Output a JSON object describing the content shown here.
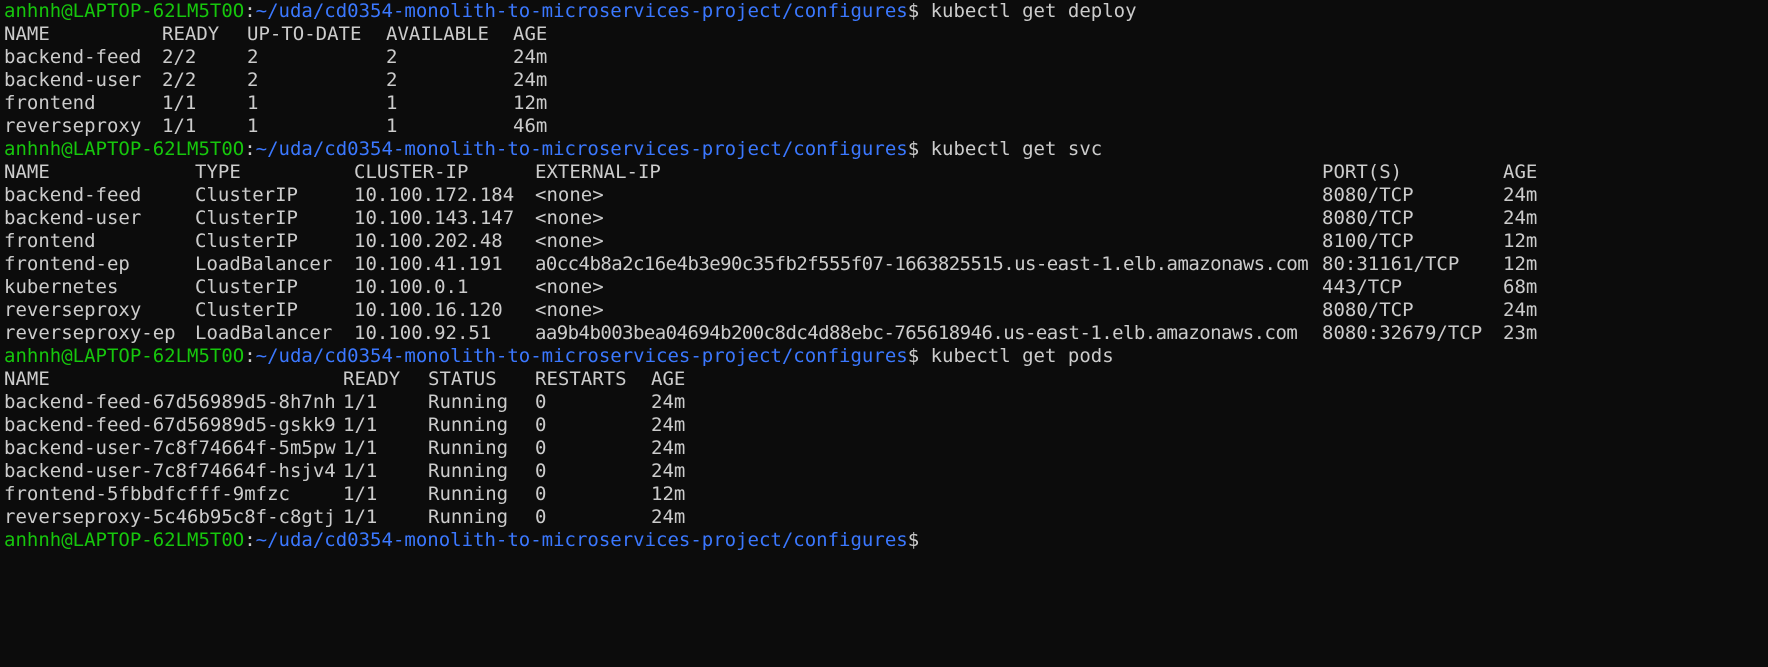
{
  "prompt": {
    "user_host": "anhnh@LAPTOP-62LM5T0O",
    "separator": ":",
    "path": "~/uda/cd0354-monolith-to-microservices-project/configures",
    "symbol": "$"
  },
  "commands": {
    "deploy": "kubectl get deploy",
    "svc": "kubectl get svc",
    "pods": "kubectl get pods"
  },
  "deploy_table": {
    "headers": [
      "NAME",
      "READY",
      "UP-TO-DATE",
      "AVAILABLE",
      "AGE"
    ],
    "rows": [
      [
        "backend-feed",
        "2/2",
        "2",
        "2",
        "24m"
      ],
      [
        "backend-user",
        "2/2",
        "2",
        "2",
        "24m"
      ],
      [
        "frontend",
        "1/1",
        "1",
        "1",
        "12m"
      ],
      [
        "reverseproxy",
        "1/1",
        "1",
        "1",
        "46m"
      ]
    ]
  },
  "svc_table": {
    "headers": [
      "NAME",
      "TYPE",
      "CLUSTER-IP",
      "EXTERNAL-IP",
      "PORT(S)",
      "AGE"
    ],
    "rows": [
      [
        "backend-feed",
        "ClusterIP",
        "10.100.172.184",
        "<none>",
        "8080/TCP",
        "24m"
      ],
      [
        "backend-user",
        "ClusterIP",
        "10.100.143.147",
        "<none>",
        "8080/TCP",
        "24m"
      ],
      [
        "frontend",
        "ClusterIP",
        "10.100.202.48",
        "<none>",
        "8100/TCP",
        "12m"
      ],
      [
        "frontend-ep",
        "LoadBalancer",
        "10.100.41.191",
        "a0cc4b8a2c16e4b3e90c35fb2f555f07-1663825515.us-east-1.elb.amazonaws.com",
        "80:31161/TCP",
        "12m"
      ],
      [
        "kubernetes",
        "ClusterIP",
        "10.100.0.1",
        "<none>",
        "443/TCP",
        "68m"
      ],
      [
        "reverseproxy",
        "ClusterIP",
        "10.100.16.120",
        "<none>",
        "8080/TCP",
        "24m"
      ],
      [
        "reverseproxy-ep",
        "LoadBalancer",
        "10.100.92.51",
        "aa9b4b003bea04694b200c8dc4d88ebc-765618946.us-east-1.elb.amazonaws.com",
        "8080:32679/TCP",
        "23m"
      ]
    ]
  },
  "pods_table": {
    "headers": [
      "NAME",
      "READY",
      "STATUS",
      "RESTARTS",
      "AGE"
    ],
    "rows": [
      [
        "backend-feed-67d56989d5-8h7nh",
        "1/1",
        "Running",
        "0",
        "24m"
      ],
      [
        "backend-feed-67d56989d5-gskk9",
        "1/1",
        "Running",
        "0",
        "24m"
      ],
      [
        "backend-user-7c8f74664f-5m5pw",
        "1/1",
        "Running",
        "0",
        "24m"
      ],
      [
        "backend-user-7c8f74664f-hsjv4",
        "1/1",
        "Running",
        "0",
        "24m"
      ],
      [
        "frontend-5fbbdfcfff-9mfzc",
        "1/1",
        "Running",
        "0",
        "12m"
      ],
      [
        "reverseproxy-5c46b95c8f-c8gtj",
        "1/1",
        "Running",
        "0",
        "24m"
      ]
    ]
  },
  "colors": {
    "background": "#0c0c0c",
    "text": "#cccccc",
    "user_host": "#16c60c",
    "path": "#3b78ff"
  }
}
